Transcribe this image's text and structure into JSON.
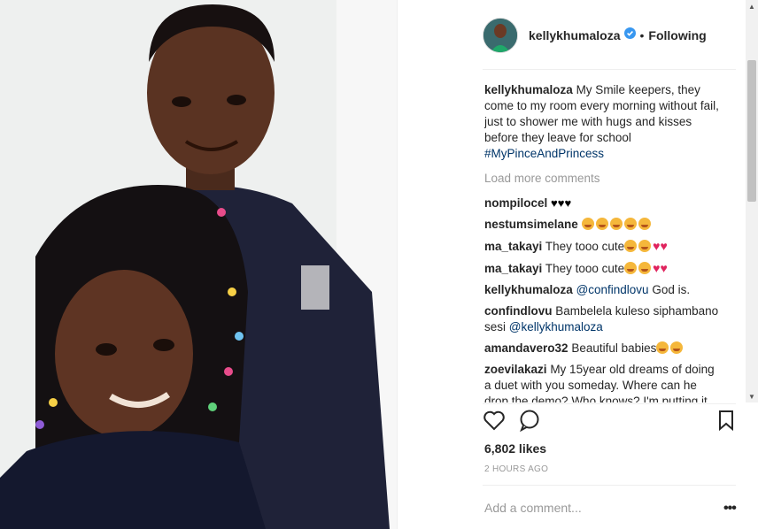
{
  "post": {
    "username": "kellykhumaloza",
    "follow_status": "Following",
    "separator": "•",
    "caption": {
      "username": "kellykhumaloza",
      "text": "My Smile keepers, they come to my room every morning without fail, just to shower me with hugs and kisses before they leave for school",
      "hashtag": "#MyPinceAndPrincess"
    },
    "load_more": "Load more comments",
    "comments": [
      {
        "username": "nompilocel",
        "text": "",
        "emoji": [
          "black-heart",
          "black-heart",
          "black-heart"
        ]
      },
      {
        "username": "nestumsimelane",
        "text": "",
        "emoji": [
          "kiss-face",
          "kiss-face",
          "kiss-face",
          "kiss-face",
          "kiss-face"
        ]
      },
      {
        "username": "ma_takayi",
        "text": "They tooo cute",
        "emoji": [
          "kiss-face",
          "kiss-face",
          "red-heart",
          "red-heart"
        ]
      },
      {
        "username": "ma_takayi",
        "text": "They tooo cute",
        "emoji": [
          "kiss-face",
          "kiss-face",
          "red-heart",
          "red-heart"
        ]
      },
      {
        "username": "kellykhumaloza",
        "mention": "@confindlovu",
        "text": "God is."
      },
      {
        "username": "confindlovu",
        "text": "Bambelela kuleso siphambano sesi",
        "mention": "@kellykhumaloza"
      },
      {
        "username": "amandavero32",
        "text": "Beautiful babies",
        "emoji": [
          "heart-eyes",
          "heart-eyes"
        ]
      },
      {
        "username": "zoevilakazi",
        "text": "My 15year old dreams of doing a duet with you someday. Where can he drop the demo? Who knows? I'm putting it"
      }
    ],
    "likes": "6,802 likes",
    "time": "2 HOURS AGO",
    "add_comment_placeholder": "Add a comment...",
    "more_options": "•••"
  },
  "colors": {
    "link": "#003569",
    "muted": "#999999",
    "heart": "#e0245e",
    "verified": "#3897f0"
  }
}
